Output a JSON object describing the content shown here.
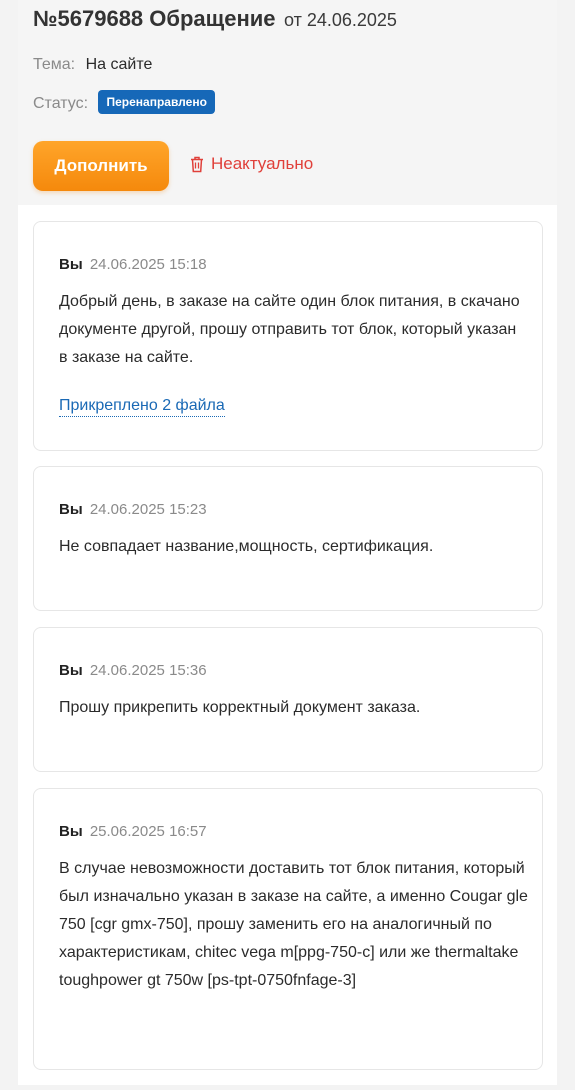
{
  "header": {
    "title": "№5679688 Обращение",
    "date_text": "от 24.06.2025",
    "topic_label": "Тема:",
    "topic_value": "На сайте",
    "status_label": "Статус:",
    "status_value": "Перенаправлено",
    "status_color": "#1668b8"
  },
  "actions": {
    "supplement_label": "Дополнить",
    "supplement_color": "#f7920f",
    "irrelevant_label": "Неактуально",
    "irrelevant_icon": "trash-icon",
    "irrelevant_color": "#e0403a"
  },
  "messages": [
    {
      "author": "Вы",
      "time": "24.06.2025 15:18",
      "text": "Добрый день, в заказе на сайте один блок питания, в скачано документе другой, прошу отправить тот блок, который указан в заказе на сайте.",
      "attachment": "Прикреплено 2 файла"
    },
    {
      "author": "Вы",
      "time": "24.06.2025 15:23",
      "text": "Не совпадает название,мощность, сертификация."
    },
    {
      "author": "Вы",
      "time": "24.06.2025 15:36",
      "text": "Прошу прикрепить корректный документ заказа."
    },
    {
      "author": "Вы",
      "time": "25.06.2025 16:57",
      "text": "В случае невозможности доставить тот блок питания, который был изначально указан в заказе на сайте, а именно Cougar gle 750 [cgr gmx-750], прошу заменить его на аналогичный по характеристикам, chitec vega m[ppg-750-c] или же thermaltake toughpower gt 750w [ps-tpt-0750fnfage-3]"
    }
  ]
}
